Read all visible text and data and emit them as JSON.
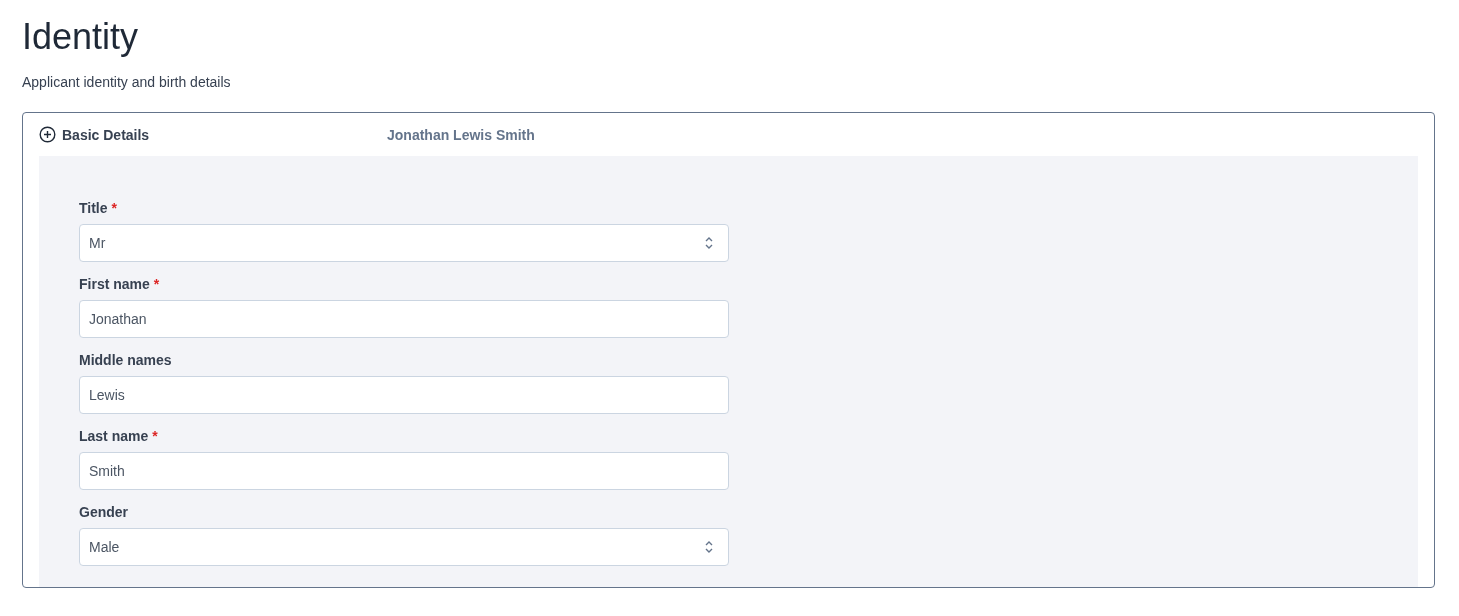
{
  "page": {
    "title": "Identity",
    "subtitle": "Applicant identity and birth details"
  },
  "section": {
    "title": "Basic Details",
    "summary": "Jonathan Lewis Smith",
    "fields": [
      {
        "kind": "select",
        "label": "Title",
        "required_mark": "*",
        "value": "Mr"
      },
      {
        "kind": "text",
        "label": "First name",
        "required_mark": "*",
        "value": "Jonathan"
      },
      {
        "kind": "text",
        "label": "Middle names",
        "value": "Lewis"
      },
      {
        "kind": "text",
        "label": "Last name",
        "required_mark": "*",
        "value": "Smith"
      },
      {
        "kind": "select",
        "label": "Gender",
        "value": "Male"
      }
    ]
  }
}
